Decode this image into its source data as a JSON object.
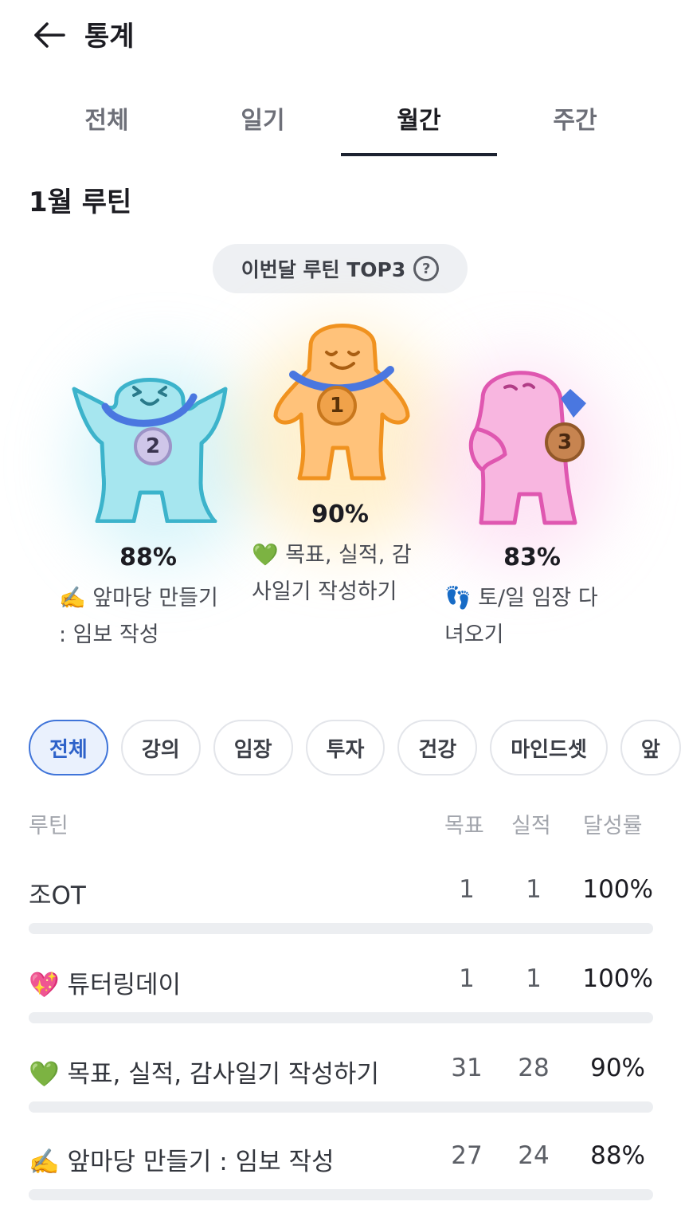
{
  "header": {
    "title": "통계",
    "back_icon": "arrow-left-icon"
  },
  "tabs": [
    {
      "label": "전체",
      "active": false
    },
    {
      "label": "일기",
      "active": false
    },
    {
      "label": "월간",
      "active": true
    },
    {
      "label": "주간",
      "active": false
    }
  ],
  "section_title": "1월 루틴",
  "top3": {
    "pill_label": "이번달 루틴 TOP3",
    "help_glyph": "?",
    "first": {
      "medal": "1",
      "percent": "90%",
      "name_line1": "💚 목표, 실적, 감",
      "name_line2": "사일기 작성하기",
      "color": "#f7a23e"
    },
    "second": {
      "medal": "2",
      "percent": "88%",
      "name_line1": "✍️ 앞마당 만들기",
      "name_line2": ": 임보 작성",
      "color": "#57c0d2"
    },
    "third": {
      "medal": "3",
      "percent": "83%",
      "name_line1": "👣 토/일 임장 다",
      "name_line2": "녀오기",
      "color": "#e867b9"
    }
  },
  "chips": [
    {
      "label": "전체",
      "active": true
    },
    {
      "label": "강의",
      "active": false
    },
    {
      "label": "임장",
      "active": false
    },
    {
      "label": "투자",
      "active": false
    },
    {
      "label": "건강",
      "active": false
    },
    {
      "label": "마인드셋",
      "active": false
    },
    {
      "label": "앞",
      "active": false
    }
  ],
  "table": {
    "headers": {
      "routine": "루틴",
      "goal": "목표",
      "actual": "실적",
      "rate": "달성률"
    },
    "rows": [
      {
        "name": "조OT",
        "goal": "1",
        "actual": "1",
        "rate": "100%",
        "progress": 1.0
      },
      {
        "name": "💖 튜터링데이",
        "goal": "1",
        "actual": "1",
        "rate": "100%",
        "progress": 1.0
      },
      {
        "name": "💚 목표, 실적, 감사일기 작성하기",
        "goal": "31",
        "actual": "28",
        "rate": "90%",
        "progress": 0.9
      },
      {
        "name": "✍️ 앞마당 만들기 : 임보 작성",
        "goal": "27",
        "actual": "24",
        "rate": "88%",
        "progress": 0.88
      }
    ]
  },
  "colors": {
    "accent": "#3f74d9",
    "tab_indicator": "#1c2230"
  }
}
